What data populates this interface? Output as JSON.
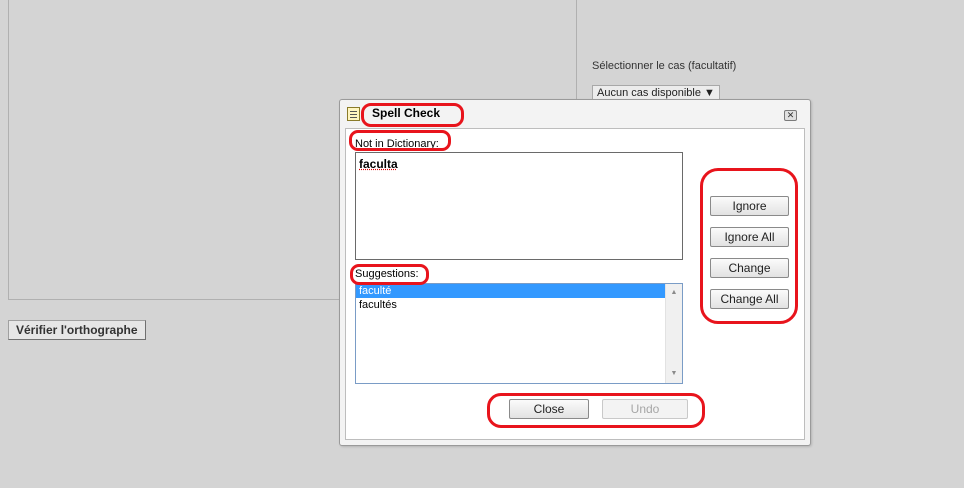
{
  "background": {
    "case_label": "Sélectionner le cas (facultatif)",
    "case_select_value": "Aucun cas disponible",
    "spellcheck_button": "Vérifier l'orthographe"
  },
  "dialog": {
    "title": "Spell Check",
    "not_in_dictionary_label": "Not in Dictionary:",
    "misspelled_word": "faculta",
    "suggestions_label": "Suggestions:",
    "suggestions": [
      "faculté",
      "facultés"
    ],
    "selected_suggestion": "faculté",
    "buttons": {
      "ignore": "Ignore",
      "ignore_all": "Ignore All",
      "change": "Change",
      "change_all": "Change All",
      "close": "Close",
      "undo": "Undo"
    }
  },
  "icons": {
    "dialog_icon": "notepad-icon",
    "close_icon": "close-icon",
    "scroll_up": "scroll-up-arrow-icon",
    "scroll_down": "scroll-down-arrow-icon",
    "select_arrow": "dropdown-arrow-icon"
  },
  "colors": {
    "annotation": "#e8141c",
    "selection": "#3399ff"
  }
}
